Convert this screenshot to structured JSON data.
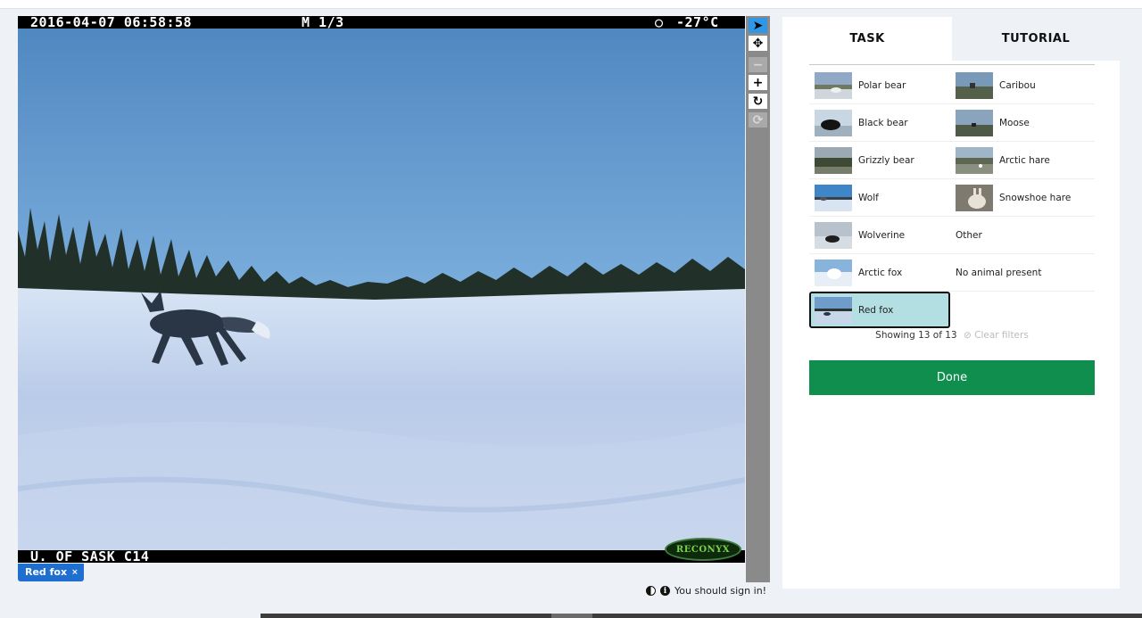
{
  "viewer": {
    "timestamp": "2016-04-07 06:58:58",
    "frame": "M 1/3",
    "temperature": "-27°C",
    "camera_label": "U. OF SASK C14",
    "brand": "RECONYX"
  },
  "tools": [
    {
      "icon": "pointer-icon",
      "glyph": "➤",
      "state": "active"
    },
    {
      "icon": "move-icon",
      "glyph": "✥",
      "state": "white"
    },
    {
      "icon": "zoom-out-icon",
      "glyph": "−",
      "state": "disabled"
    },
    {
      "icon": "zoom-in-icon",
      "glyph": "+",
      "state": "white"
    },
    {
      "icon": "rotate-icon",
      "glyph": "↻",
      "state": "white"
    },
    {
      "icon": "reset-icon",
      "glyph": "⟳",
      "state": "disabled"
    }
  ],
  "tag": {
    "label": "Red fox",
    "remove": "×"
  },
  "footer": {
    "signin": "You should sign in!"
  },
  "tabs": {
    "task": "TASK",
    "tutorial": "TUTORIAL"
  },
  "choices": [
    {
      "label": "Polar bear",
      "thumb": "polar-bear-thumbnail"
    },
    {
      "label": "Caribou",
      "thumb": "caribou-thumbnail"
    },
    {
      "label": "Black bear",
      "thumb": "black-bear-thumbnail"
    },
    {
      "label": "Moose",
      "thumb": "moose-thumbnail"
    },
    {
      "label": "Grizzly bear",
      "thumb": "grizzly-bear-thumbnail"
    },
    {
      "label": "Arctic hare",
      "thumb": "arctic-hare-thumbnail"
    },
    {
      "label": "Wolf",
      "thumb": "wolf-thumbnail"
    },
    {
      "label": "Snowshoe hare",
      "thumb": "snowshoe-hare-thumbnail"
    },
    {
      "label": "Wolverine",
      "thumb": "wolverine-thumbnail"
    },
    {
      "label": "Other",
      "thumb": null
    },
    {
      "label": "Arctic fox",
      "thumb": "arctic-fox-thumbnail"
    },
    {
      "label": "No animal present",
      "thumb": null
    },
    {
      "label": "Red fox",
      "thumb": "red-fox-thumbnail",
      "selected": true
    }
  ],
  "showing": "Showing 13 of 13",
  "clear_filters": "Clear filters",
  "done": "Done",
  "colors": {
    "accent_blue": "#1f6fd1",
    "done_green": "#0f8e4e",
    "selected_bg": "#b4dfe2"
  }
}
